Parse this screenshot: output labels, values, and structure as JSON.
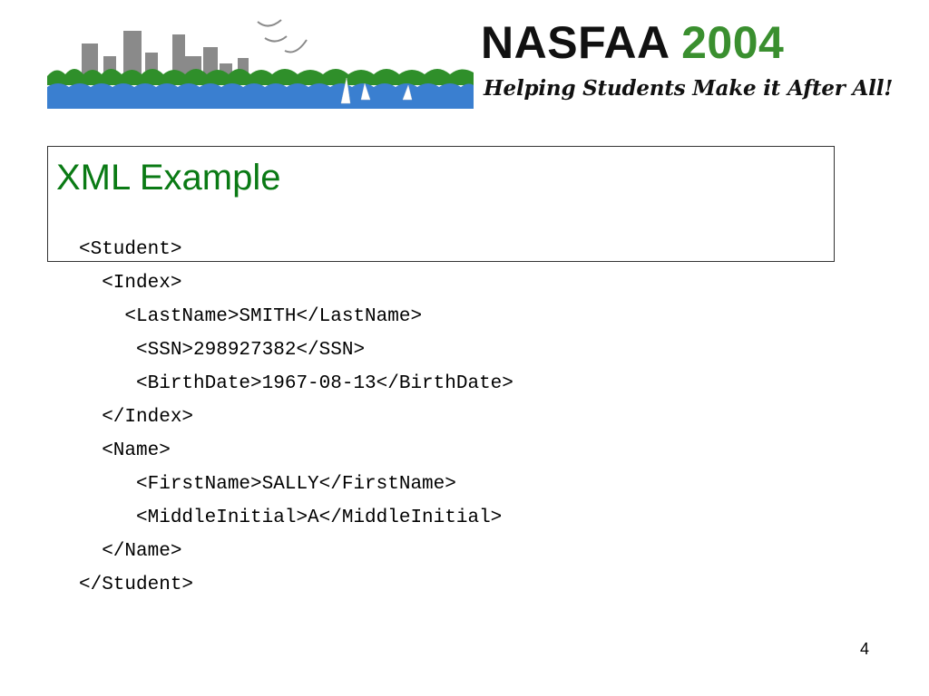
{
  "header": {
    "logo_title_part1": "NASFAA ",
    "logo_title_part2": "2004",
    "tagline": "Helping Students Make it After All!",
    "banner_image": "city-skyline-lake-sailboats-birds-illustration"
  },
  "slide": {
    "title": "XML Example",
    "code_lines": [
      "<Student>",
      "  <Index>",
      "    <LastName>SMITH</LastName>",
      "     <SSN>298927382</SSN>",
      "     <BirthDate>1967-08-13</BirthDate>",
      "  </Index>",
      "  <Name>",
      "     <FirstName>SALLY</FirstName>",
      "     <MiddleInitial>A</MiddleInitial>",
      "  </Name>",
      "</Student>"
    ],
    "page_number": "4"
  },
  "colors": {
    "title_green": "#0a7a14",
    "logo_year_green": "#3a8f2f",
    "lake_blue": "#3a7fd0",
    "tree_green": "#2f8f2a",
    "building_gray": "#8a8a8a"
  }
}
